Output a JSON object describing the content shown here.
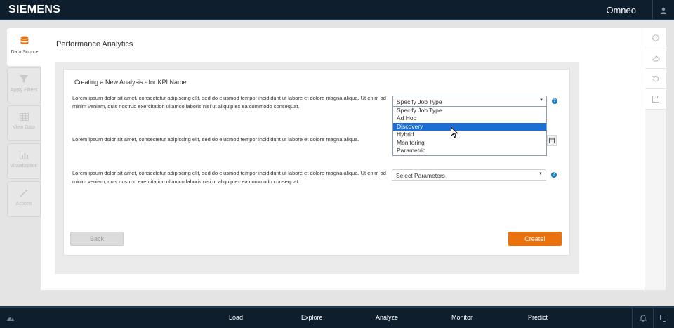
{
  "header": {
    "logo": "SIEMENS",
    "app_name": "Omneo"
  },
  "left_tabs": [
    {
      "label": "Data Source",
      "icon": "database-icon",
      "active": true
    },
    {
      "label": "Apply Filters",
      "icon": "filter-icon",
      "active": false
    },
    {
      "label": "View Data",
      "icon": "table-icon",
      "active": false
    },
    {
      "label": "Visualization",
      "icon": "chart-icon",
      "active": false
    },
    {
      "label": "Actions",
      "icon": "wand-icon",
      "active": false
    }
  ],
  "page": {
    "title": "Performance Analytics"
  },
  "form": {
    "title": "Creating a New Analysis - for KPI Name",
    "row1_text": "Lorem ipsum dolor sit amet, consectetur adipiscing elit, sed do eiusmod tempor incididunt  ut labore et dolore magna aliqua. Ut enim ad minim veniam, quis nostrud exercitation ullamco laboris nisi ut aliquip ex ea commodo consequat.",
    "row2_text": "Lorem ipsum dolor sit amet, consectetur adipiscing elit, sed do eiusmod tempor incididunt ut labore et dolore magna aliqua.",
    "row3_text": "Lorem ipsum dolor sit amet, consectetur adipiscing elit, sed do eiusmod tempor incididunt ut labore et dolore magna aliqua. Ut enim ad minim veniam, quis nostrud exercitation ullamco laboris nisi ut aliquip ex ea commodo consequat.",
    "job_type_select": {
      "value": "Specify Job Type",
      "options": [
        "Specify Job Type",
        "Ad Hoc",
        "Discovery",
        "Hybrid",
        "Monitoring",
        "Parametric"
      ],
      "highlighted": "Discovery"
    },
    "params_select": {
      "value": "Select Parameters"
    },
    "back_label": "Back",
    "create_label": "Create!"
  },
  "right_tools": [
    "help-icon",
    "eraser-icon",
    "undo-icon",
    "save-icon"
  ],
  "bottom_nav": {
    "items": [
      "Load",
      "Explore",
      "Analyze",
      "Monitor",
      "Predict"
    ]
  },
  "colors": {
    "bar": "#0f1e2d",
    "accent": "#e8720d",
    "highlight": "#1a6fd4",
    "help": "#1a7fb8"
  }
}
